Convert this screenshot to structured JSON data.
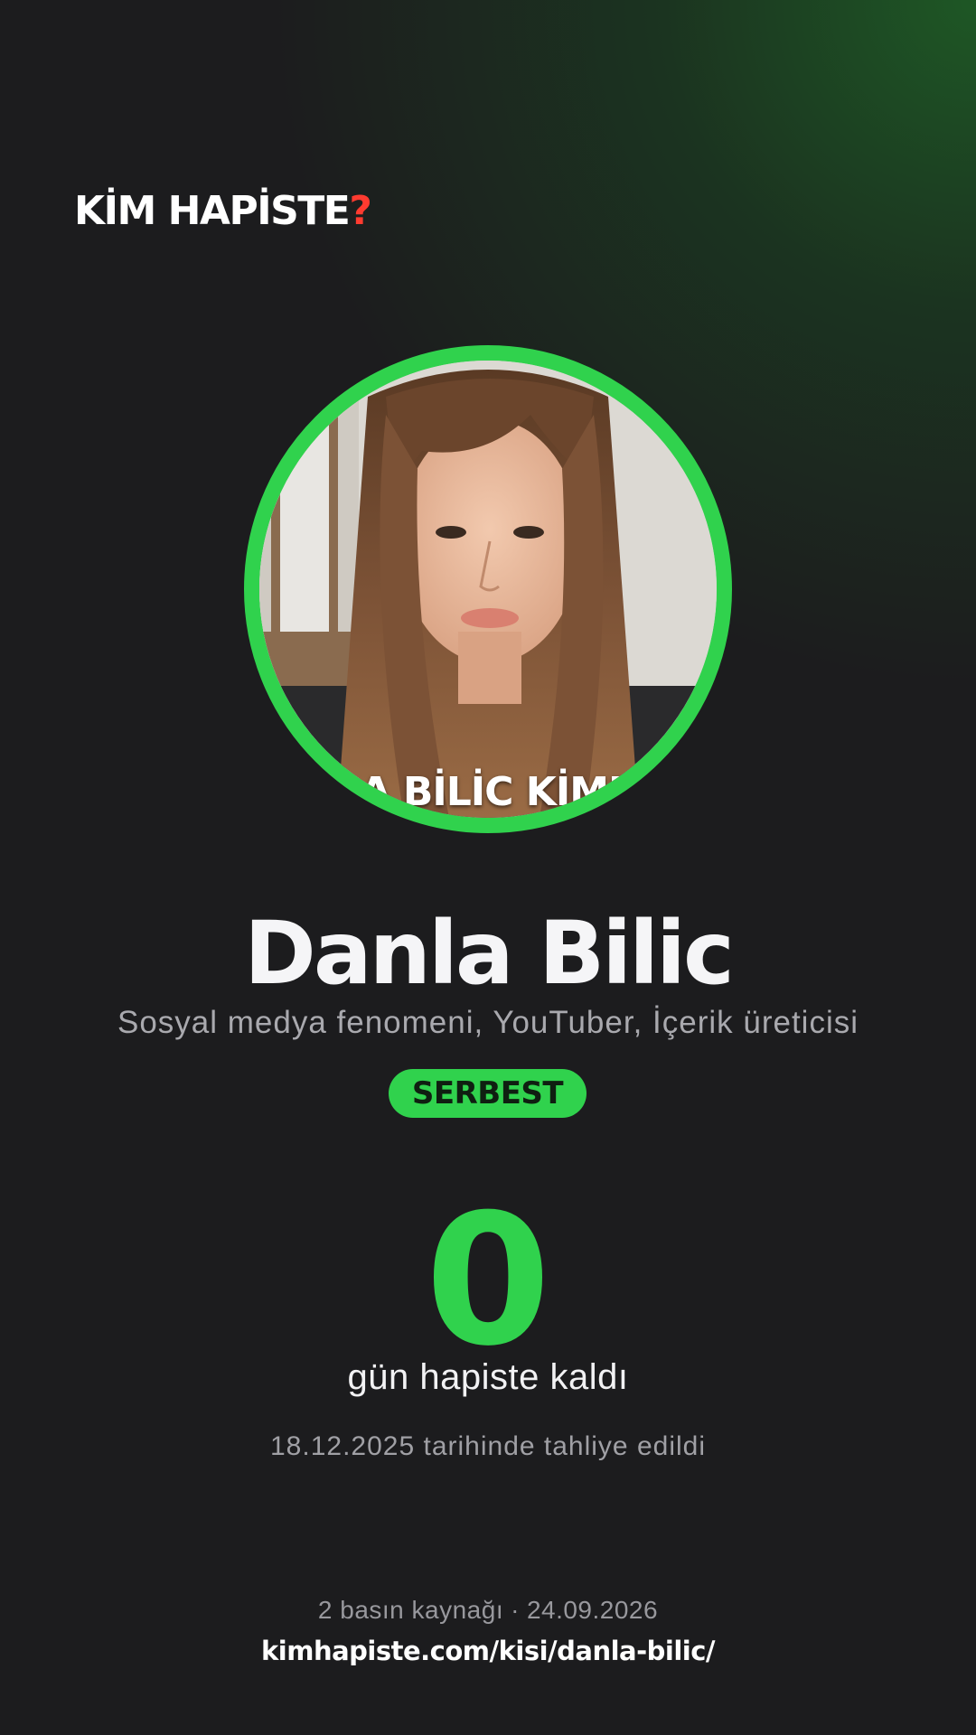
{
  "brand": {
    "name": "KİM HAPİSTE",
    "mark": "?",
    "mark_color": "#ff3b30"
  },
  "profile": {
    "photo_caption": "LA BİLİC KİMD",
    "photo_border_color": "#30d24d",
    "name": "Danla Bilic",
    "occupation": "Sosyal medya fenomeni, YouTuber, İçerik üreticisi",
    "status": "SERBEST",
    "status_color": "#30d24d"
  },
  "counter": {
    "value": "0",
    "label": "gün hapiste kaldı",
    "release_note": "18.12.2025 tarihinde tahliye edildi"
  },
  "footer": {
    "sources": "2 basın kaynağı",
    "separator": "·",
    "date": "24.09.2026",
    "url": "kimhapiste.com/kisi/danla-bilic/"
  },
  "colors": {
    "background": "#1c1c1e",
    "accent_green": "#30d24d",
    "glow_green": "#1f6e28"
  }
}
